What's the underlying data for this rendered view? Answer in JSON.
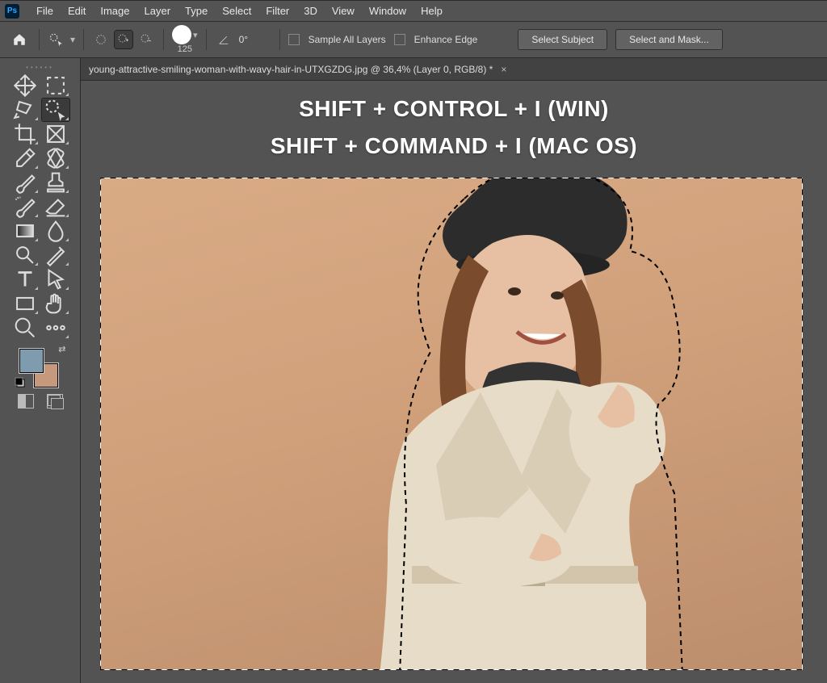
{
  "menubar": {
    "items": [
      "File",
      "Edit",
      "Image",
      "Layer",
      "Type",
      "Select",
      "Filter",
      "3D",
      "View",
      "Window",
      "Help"
    ]
  },
  "optionsbar": {
    "brush_size": "125",
    "angle_value": "0°",
    "sample_all_label": "Sample All Layers",
    "enhance_edge_label": "Enhance Edge",
    "select_subject_label": "Select Subject",
    "select_and_mask_label": "Select and Mask..."
  },
  "document": {
    "tab_title": "young-attractive-smiling-woman-with-wavy-hair-in-UTXGZDG.jpg @ 36,4% (Layer 0, RGB/8) *"
  },
  "overlay": {
    "line1": "SHIFT + CONTROL + I (WIN)",
    "line2": "SHIFT + COMMAND + I (MAC OS)"
  },
  "swatches": {
    "foreground": "#7f9caf",
    "background": "#c6997c"
  },
  "tools": [
    {
      "name": "move-tool"
    },
    {
      "name": "marquee-tool"
    },
    {
      "name": "lasso-tool"
    },
    {
      "name": "quick-selection-tool",
      "selected": true
    },
    {
      "name": "crop-tool"
    },
    {
      "name": "frame-tool"
    },
    {
      "name": "eyedropper-tool"
    },
    {
      "name": "patch-tool"
    },
    {
      "name": "brush-tool"
    },
    {
      "name": "stamp-tool"
    },
    {
      "name": "history-brush-tool"
    },
    {
      "name": "eraser-tool"
    },
    {
      "name": "gradient-tool"
    },
    {
      "name": "blur-tool"
    },
    {
      "name": "dodge-tool"
    },
    {
      "name": "pen-tool"
    },
    {
      "name": "type-tool"
    },
    {
      "name": "path-selection-tool"
    },
    {
      "name": "rectangle-tool"
    },
    {
      "name": "hand-tool"
    },
    {
      "name": "zoom-tool"
    },
    {
      "name": "more-tool"
    }
  ]
}
